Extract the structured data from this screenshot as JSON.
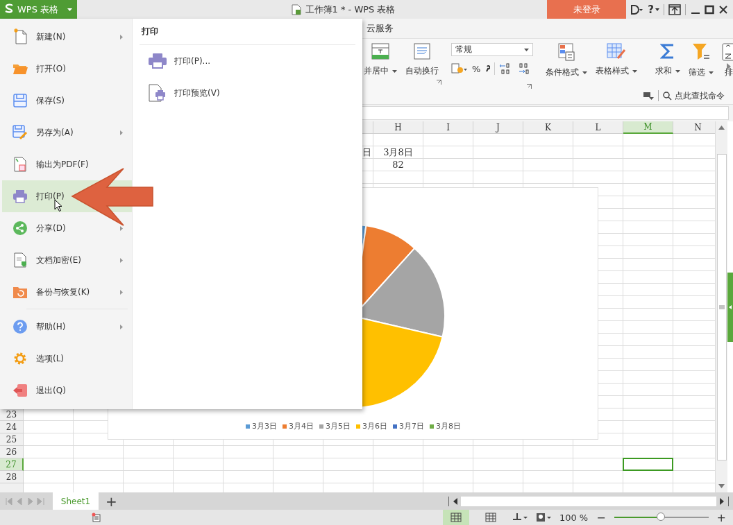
{
  "app_button": {
    "label": "WPS 表格"
  },
  "window": {
    "title": "工作簿1 * - WPS 表格"
  },
  "login_button": {
    "label": "未登录"
  },
  "help_button": {
    "label": "?"
  },
  "ribbon_tabs": [
    {
      "label": "云服务"
    }
  ],
  "ribbon": {
    "left_buttons": [
      {
        "label": "并居中",
        "dropdown": true
      },
      {
        "label": "自动换行",
        "dropdown": false
      }
    ],
    "number_format": {
      "value": "常规"
    },
    "percent": "%",
    "right_buttons": [
      {
        "label": "条件格式",
        "dropdown": true
      },
      {
        "label": "表格样式",
        "dropdown": true
      },
      {
        "label": "求和",
        "dropdown": true
      },
      {
        "label": "筛选",
        "dropdown": true
      },
      {
        "label": "排",
        "dropdown": false
      }
    ]
  },
  "command_search": {
    "placeholder": "点此查找命令"
  },
  "menu": {
    "items": [
      {
        "label": "新建(N)",
        "submenu": true,
        "selected": false
      },
      {
        "label": "打开(O)",
        "submenu": false,
        "selected": false
      },
      {
        "label": "保存(S)",
        "submenu": false,
        "selected": false
      },
      {
        "label": "另存为(A)",
        "submenu": true,
        "selected": false
      },
      {
        "label": "输出为PDF(F)",
        "submenu": false,
        "selected": false
      },
      {
        "label": "打印(P)",
        "submenu": true,
        "selected": true
      },
      {
        "label": "分享(D)",
        "submenu": true,
        "selected": false
      },
      {
        "label": "文档加密(E)",
        "submenu": true,
        "selected": false
      },
      {
        "label": "备份与恢复(K)",
        "submenu": true,
        "selected": false
      },
      {
        "label": "帮助(H)",
        "submenu": true,
        "selected": false
      },
      {
        "label": "选项(L)",
        "submenu": false,
        "selected": false
      },
      {
        "label": "退出(Q)",
        "submenu": false,
        "selected": false
      }
    ],
    "panel": {
      "title": "打印",
      "items": [
        "打印(P)...",
        "打印预览(V)"
      ]
    }
  },
  "grid": {
    "columns": [
      {
        "label": "H",
        "selected": false
      },
      {
        "label": "I",
        "selected": false
      },
      {
        "label": "J",
        "selected": false
      },
      {
        "label": "K",
        "selected": false
      },
      {
        "label": "L",
        "selected": false
      },
      {
        "label": "M",
        "selected": true
      },
      {
        "label": "N",
        "selected": false
      }
    ],
    "rows": [
      {
        "label": "23",
        "selected": false
      },
      {
        "label": "24",
        "selected": false
      },
      {
        "label": "25",
        "selected": false
      },
      {
        "label": "26",
        "selected": false
      },
      {
        "label": "27",
        "selected": true
      },
      {
        "label": "28",
        "selected": false
      }
    ],
    "cells": [
      [
        "日",
        "3月8日"
      ],
      [
        "82"
      ]
    ]
  },
  "chart": {
    "legend": [
      {
        "label": "3月3日",
        "color": "#5b9bd5"
      },
      {
        "label": "3月4日",
        "color": "#ed7d31"
      },
      {
        "label": "3月5日",
        "color": "#a5a5a5"
      },
      {
        "label": "3月6日",
        "color": "#ffc000"
      },
      {
        "label": "3月7日",
        "color": "#4472c4"
      },
      {
        "label": "3月8日",
        "color": "#70ad47"
      }
    ]
  },
  "sheets": [
    {
      "label": "Sheet1",
      "selected": true
    }
  ],
  "add_sheet": "+",
  "status": {
    "views": [
      {
        "selected": true
      },
      {
        "selected": false
      }
    ],
    "zoom": "100 %",
    "zoom_out": "−",
    "zoom_in": "+",
    "zoom_slider": {
      "level": 0.5
    }
  }
}
